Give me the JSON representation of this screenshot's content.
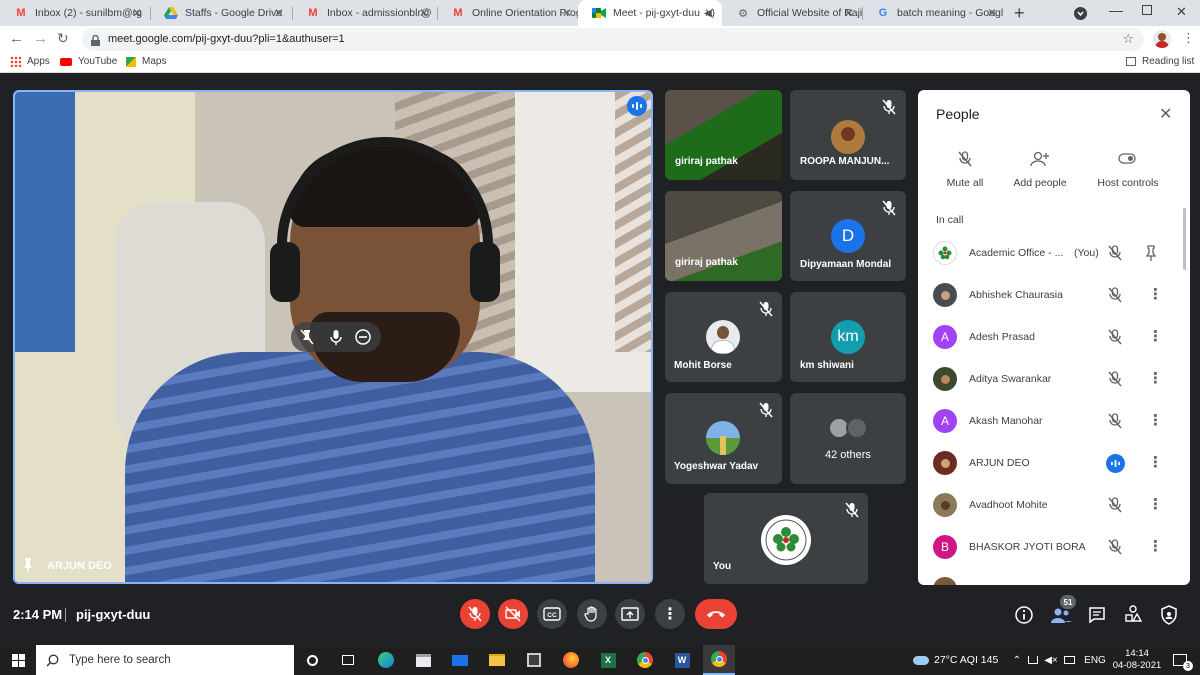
{
  "browser": {
    "tabs": [
      {
        "title": "Inbox (2) - sunilbm@rg",
        "icon": "gmail-icon"
      },
      {
        "title": "Staffs - Google Drive",
        "icon": "drive-icon"
      },
      {
        "title": "Inbox - admissionblr@",
        "icon": "gmail-icon"
      },
      {
        "title": "Online Orientation Prog",
        "icon": "gmail-icon"
      },
      {
        "title": "Meet - pij-gxyt-duu",
        "icon": "meet-icon"
      },
      {
        "title": "Official Website of Rajiv",
        "icon": "globe-icon"
      },
      {
        "title": "batch meaning - Googl",
        "icon": "google-icon"
      }
    ],
    "url": "meet.google.com/pij-gxyt-duu?pli=1&authuser=1",
    "bookmarks": [
      "Apps",
      "YouTube",
      "Maps"
    ],
    "reading_list": "Reading list"
  },
  "meet": {
    "main_speaker": "ARJUN DEO",
    "tiles": [
      {
        "name": "giriraj pathak"
      },
      {
        "name": "ROOPA MANJUN..."
      },
      {
        "name": "giriraj pathak"
      },
      {
        "name": "Dipyamaan Mondal",
        "initial": "D"
      },
      {
        "name": "Mohit Borse"
      },
      {
        "name": "km shiwani",
        "initial": "km"
      },
      {
        "name": "Yogeshwar Yadav"
      },
      {
        "name": "42 others"
      },
      {
        "name": "You"
      }
    ],
    "time": "2:14 PM",
    "meeting_code": "pij-gxyt-duu",
    "participant_count": "51",
    "colors": {
      "accent": "#8ab4f8",
      "red": "#ea4335",
      "speaking": "#1a73e8"
    }
  },
  "people_panel": {
    "title": "People",
    "actions": [
      "Mute all",
      "Add people",
      "Host controls"
    ],
    "section": "In call",
    "participants": [
      {
        "name": "Academic Office - ...",
        "suffix": "(You)"
      },
      {
        "name": "Abhishek Chaurasia"
      },
      {
        "name": "Adesh Prasad",
        "initial": "A",
        "color": "#a142f4"
      },
      {
        "name": "Aditya Swarankar"
      },
      {
        "name": "Akash Manohar",
        "initial": "A",
        "color": "#a142f4"
      },
      {
        "name": "ARJUN DEO"
      },
      {
        "name": "Avadhoot Mohite"
      },
      {
        "name": "BHASKOR JYOTI BORA",
        "initial": "B",
        "color": "#d01884"
      }
    ]
  },
  "taskbar": {
    "search_placeholder": "Type here to search",
    "weather": "27°C AQI 145",
    "language": "ENG",
    "clock_time": "14:14",
    "clock_date": "04-08-2021",
    "notifications": "3"
  }
}
